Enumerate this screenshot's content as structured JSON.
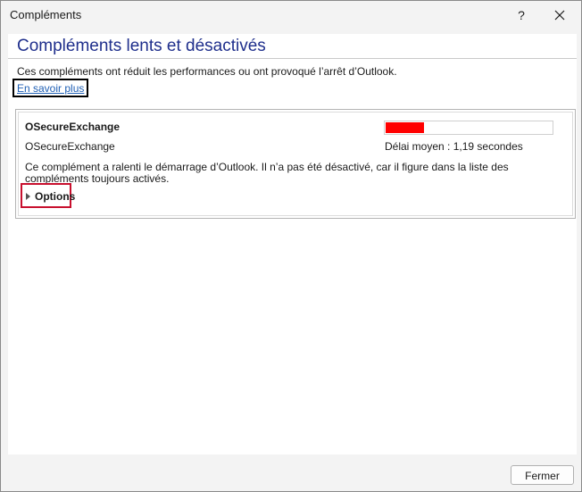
{
  "window": {
    "title": "Compléments",
    "help_label": "?"
  },
  "main": {
    "heading": "Compléments lents et désactivés",
    "intro": "Ces compléments ont réduit les performances ou ont provoqué l’arrêt d’Outlook.",
    "learn_more": "En savoir plus"
  },
  "addin": {
    "name": "OSecureExchange",
    "publisher": "OSecureExchange",
    "avg_delay": "Délai moyen : 1,19 secondes",
    "impact_level": 0.23,
    "impact_color": "#ff0000",
    "description": "Ce complément a ralenti le démarrage d’Outlook. Il n’a pas été désactivé, car il figure dans la liste des compléments toujours activés.",
    "options_label": "Options"
  },
  "footer": {
    "close_label": "Fermer"
  },
  "colors": {
    "heading": "#1f2f8c",
    "link": "#1f5fb4",
    "highlight_border": "#c8102e"
  }
}
